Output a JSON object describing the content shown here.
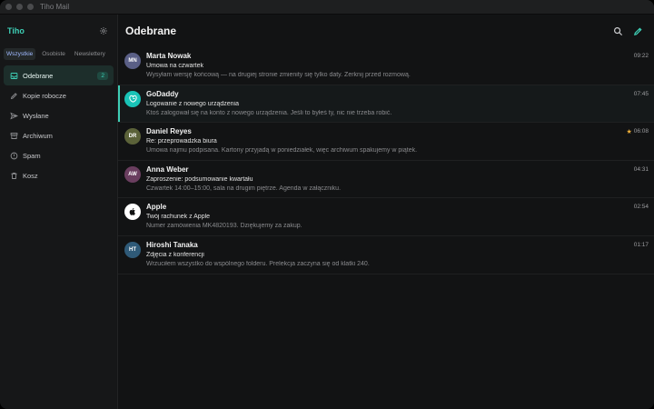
{
  "window": {
    "title": "Tiho Mail"
  },
  "sidebar": {
    "brand": "Tiho",
    "filters": [
      "Wszystkie",
      "Osobiste",
      "Newslettery"
    ],
    "items": [
      {
        "label": "Odebrane",
        "icon": "inbox-icon",
        "badge": "2",
        "active": true
      },
      {
        "label": "Kopie robocze",
        "icon": "pencil-icon",
        "badge": ""
      },
      {
        "label": "Wysłane",
        "icon": "send-icon",
        "badge": ""
      },
      {
        "label": "Archiwum",
        "icon": "archive-icon",
        "badge": ""
      },
      {
        "label": "Spam",
        "icon": "alert-circle-icon",
        "badge": ""
      },
      {
        "label": "Kosz",
        "icon": "trash-icon",
        "badge": ""
      }
    ]
  },
  "main": {
    "title": "Odebrane"
  },
  "messages": [
    {
      "initials": "MN",
      "avatar_color": "#5a5f86",
      "sender": "Marta Nowak",
      "time": "09:22",
      "subject": "Umowa na czwartek",
      "preview": "Wysyłam wersję końcową — na drugiej stronie zmienity się tylko daty. Zerknij przed rozmową.",
      "starred": false
    },
    {
      "initials": "",
      "avatar_color": "#19c3b7",
      "sender": "GoDaddy",
      "time": "07:45",
      "subject": "Logowanie z nowego urządzenia",
      "preview": "Ktoś zalogował się na konto z nowego urządzenia. Jeśli to byłeś ty, nic nie trzeba robić.",
      "starred": false,
      "selected": true
    },
    {
      "initials": "DR",
      "avatar_color": "#5b6239",
      "sender": "Daniel Reyes",
      "time": "06:08",
      "subject": "Re: przeprowadzka biura",
      "preview": "Umowa najmu podpisana. Kartony przyjadą w poniedziałek, więc archiwum spakujemy w piątek.",
      "starred": true
    },
    {
      "initials": "AW",
      "avatar_color": "#6a3e5f",
      "sender": "Anna Weber",
      "time": "04:31",
      "subject": "Zaproszenie: podsumowanie kwartału",
      "preview": "Czwartek 14:00–15:00, sala na drugim piętrze. Agenda w załączniku.",
      "starred": false
    },
    {
      "initials": "",
      "avatar_color": "#ffffff",
      "sender": "Apple",
      "time": "02:54",
      "subject": "Twój rachunek z Apple",
      "preview": "Numer zamówienia MK4820193. Dziękujemy za zakup.",
      "starred": false
    },
    {
      "initials": "HT",
      "avatar_color": "#2f5a78",
      "sender": "Hiroshi Tanaka",
      "time": "01:17",
      "subject": "Zdjęcia z konferencji",
      "preview": "Wrzuciłem wszystko do wspólnego folderu. Prelekcja zaczyna się od klatki 240.",
      "starred": false
    }
  ]
}
